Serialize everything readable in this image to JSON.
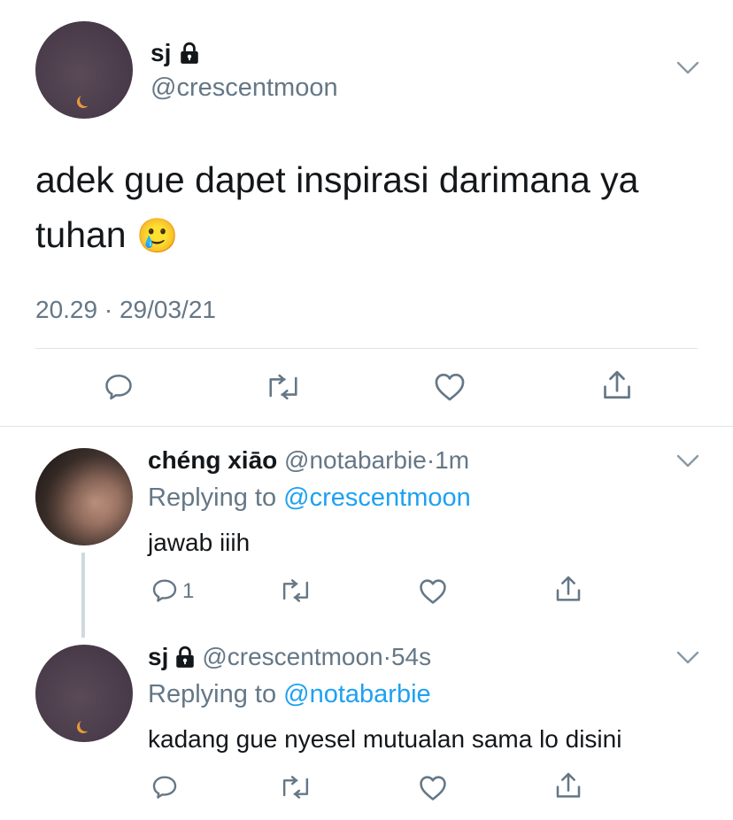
{
  "main_tweet": {
    "display_name": "sj",
    "handle": "@crescentmoon",
    "text_line1": "adek gue dapet inspirasi darimana ya",
    "text_line2": "tuhan",
    "emoji": "🥲",
    "time": "20.29",
    "date": "29/03/21",
    "dot": "·"
  },
  "reply1": {
    "display_name": "chéng xiāo",
    "handle": "@notabarbie",
    "dot": "·",
    "age": "1m",
    "replying_prefix": "Replying to",
    "replying_to": "@crescentmoon",
    "text": "jawab iiih",
    "reply_count": "1"
  },
  "reply2": {
    "display_name": "sj",
    "handle": "@crescentmoon",
    "dot": "·",
    "age": "54s",
    "replying_prefix": "Replying to",
    "replying_to": "@notabarbie",
    "text": "kadang gue nyesel mutualan sama lo disini"
  },
  "colors": {
    "text": "#14171a",
    "secondary": "#657786",
    "link": "#1da1f2",
    "divider": "#dfe5ea"
  }
}
